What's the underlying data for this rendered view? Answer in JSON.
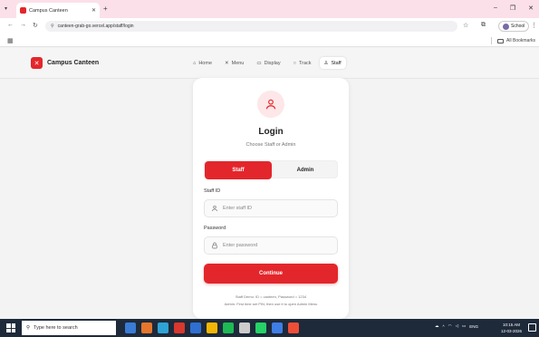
{
  "browser": {
    "tab_title": "Campus Canteen",
    "url": "canteen-grab-go.vercel.app/staff/login",
    "profile_label": "School",
    "all_bookmarks": "All Bookmarks"
  },
  "app": {
    "brand": "Campus Canteen",
    "nav": [
      {
        "label": "Home",
        "icon": "home-icon"
      },
      {
        "label": "Menu",
        "icon": "utensils-icon"
      },
      {
        "label": "Display",
        "icon": "monitor-icon"
      },
      {
        "label": "Track",
        "icon": "search-icon"
      },
      {
        "label": "Staff",
        "icon": "user-icon",
        "active": true
      }
    ]
  },
  "login": {
    "title": "Login",
    "subtitle": "Choose Staff or Admin",
    "toggle_staff": "Staff",
    "toggle_admin": "Admin",
    "staff_id_label": "Staff ID",
    "staff_id_placeholder": "Enter staff ID",
    "password_label": "Password",
    "password_placeholder": "Enter password",
    "submit": "Continue",
    "note_1": "Staff Demo: ID = canteen, Password = 1234",
    "note_2": "Admin: First time set PIN, then use it to open Admin Menu",
    "accent": "#e3262b"
  },
  "taskbar": {
    "search_placeholder": "Type here to search",
    "time": "10:15 AM",
    "date": "12-03-2026",
    "lang": "ENG"
  }
}
